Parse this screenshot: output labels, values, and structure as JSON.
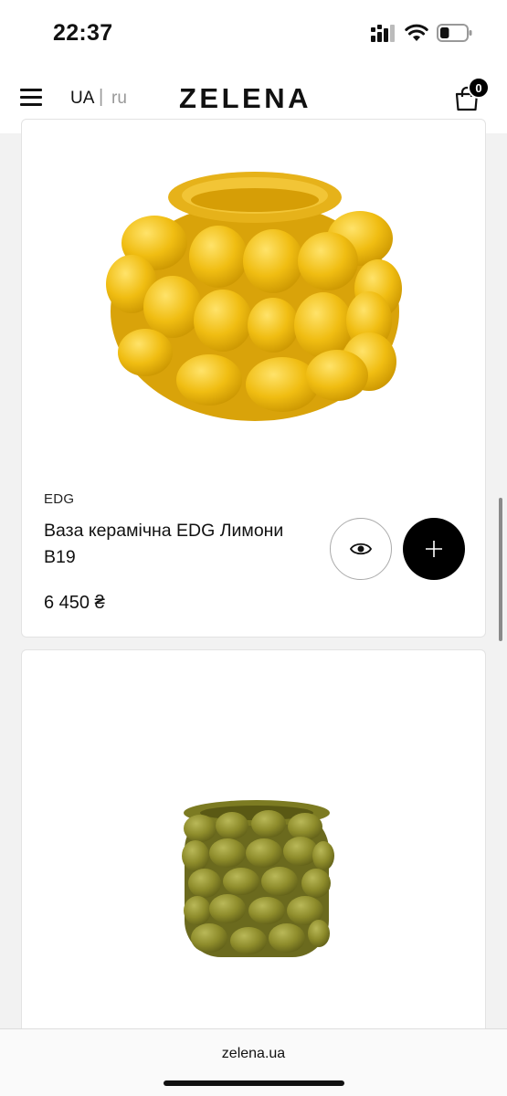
{
  "status_bar": {
    "time": "22:37",
    "battery_level": 0.35
  },
  "header": {
    "lang_active": "UA",
    "lang_separator": "|",
    "lang_alt": "ru",
    "logo": "ZELENA",
    "cart_count": "0"
  },
  "products": [
    {
      "brand": "EDG",
      "name": "Ваза керамічна EDG Лимони B19",
      "price": "6 450 ₴",
      "image": "yellow-lemon-ceramic-vase",
      "color": "#f2c21b"
    },
    {
      "brand": "",
      "name": "",
      "price": "",
      "image": "olive-green-lemon-ceramic-vase",
      "color": "#8a8a2a"
    }
  ],
  "browser": {
    "url": "zelena.ua"
  },
  "icons": {
    "menu": "menu-icon",
    "cart": "shopping-bag-icon",
    "quick_view": "eye-icon",
    "add": "plus-icon"
  }
}
